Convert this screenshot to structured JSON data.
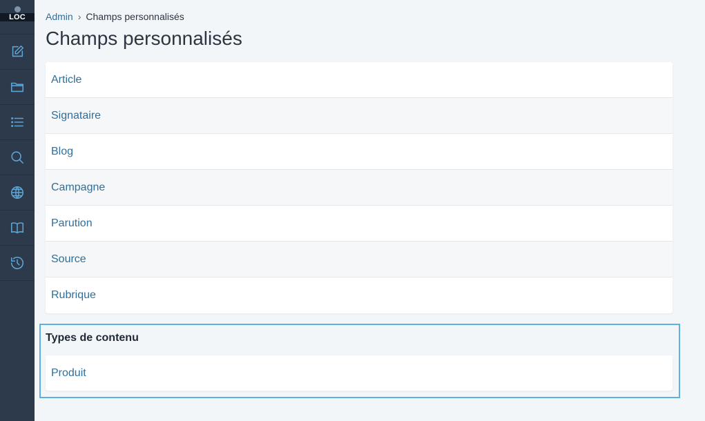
{
  "sidebar": {
    "logo": "LOC",
    "items": [
      {
        "icon": "edit-icon"
      },
      {
        "icon": "folder-icon"
      },
      {
        "icon": "list-icon"
      },
      {
        "icon": "search-icon"
      },
      {
        "icon": "globe-icon"
      },
      {
        "icon": "book-icon"
      },
      {
        "icon": "history-icon"
      }
    ]
  },
  "breadcrumb": {
    "root": "Admin",
    "separator": "›",
    "current": "Champs personnalisés"
  },
  "page": {
    "title": "Champs personnalisés"
  },
  "list": [
    "Article",
    "Signataire",
    "Blog",
    "Campagne",
    "Parution",
    "Source",
    "Rubrique"
  ],
  "content_types": {
    "title": "Types de contenu",
    "items": [
      "Produit"
    ]
  },
  "colors": {
    "sidebar": "#2c3a4b",
    "accent": "#5ea5d6",
    "link": "#2f6f9a",
    "focus_border": "#5bb1df"
  }
}
